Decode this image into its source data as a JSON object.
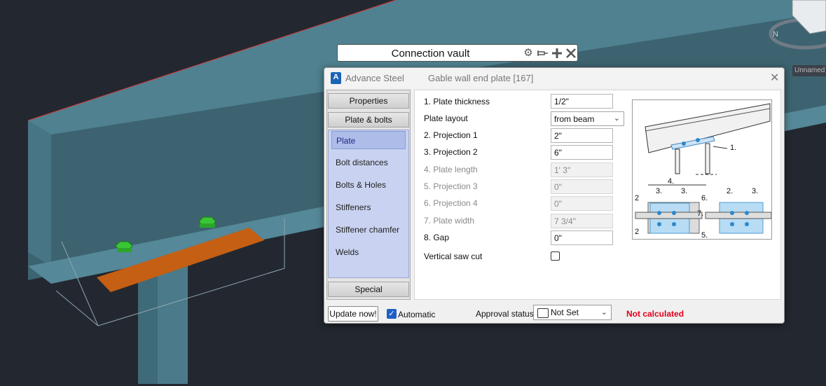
{
  "viewport": {
    "background": "#232830",
    "unnamed_label": "Unnamed"
  },
  "floating_toolbar": {
    "title": "Connection vault",
    "icons": [
      "gear-icon",
      "pin-icon",
      "move-icon",
      "close-icon"
    ]
  },
  "dialog": {
    "app_name": "Advance Steel",
    "title": "Gable wall end plate [167]",
    "categories": {
      "properties": "Properties",
      "plate_bolts": "Plate & bolts",
      "special": "Special"
    },
    "subitems": [
      {
        "label": "Plate",
        "selected": true
      },
      {
        "label": "Bolt distances",
        "selected": false
      },
      {
        "label": "Bolts & Holes",
        "selected": false
      },
      {
        "label": "Stiffeners",
        "selected": false
      },
      {
        "label": "Stiffener chamfer",
        "selected": false
      },
      {
        "label": "Welds",
        "selected": false
      }
    ],
    "fields": [
      {
        "label": "1. Plate thickness",
        "value": "1/2\"",
        "enabled": true
      },
      {
        "label": "Plate layout",
        "value": "from beam",
        "enabled": true,
        "type": "dropdown"
      },
      {
        "label": "2. Projection 1",
        "value": "2\"",
        "enabled": true
      },
      {
        "label": "3. Projection 2",
        "value": "6\"",
        "enabled": true
      },
      {
        "label": "4. Plate length",
        "value": "1' 3\"",
        "enabled": false
      },
      {
        "label": "5. Projection 3",
        "value": "0\"",
        "enabled": false
      },
      {
        "label": "6. Projection 4",
        "value": "0\"",
        "enabled": false
      },
      {
        "label": "7. Plate width",
        "value": "7 3/4\"",
        "enabled": false
      },
      {
        "label": "8. Gap",
        "value": "0\"",
        "enabled": true
      },
      {
        "label": "Vertical saw cut",
        "checked": false,
        "type": "checkbox"
      }
    ],
    "diagram_labels": [
      "1.",
      "2",
      "3.",
      "4.",
      "3.",
      "6.",
      "2.",
      "3.",
      "7.",
      "2",
      "5."
    ],
    "bottom": {
      "update_label": "Update now!",
      "automatic_label": "Automatic",
      "automatic_checked": true,
      "approval_label": "Approval status",
      "approval_value": "Not Set",
      "status_text": "Not calculated",
      "status_color": "#e0001b"
    }
  }
}
